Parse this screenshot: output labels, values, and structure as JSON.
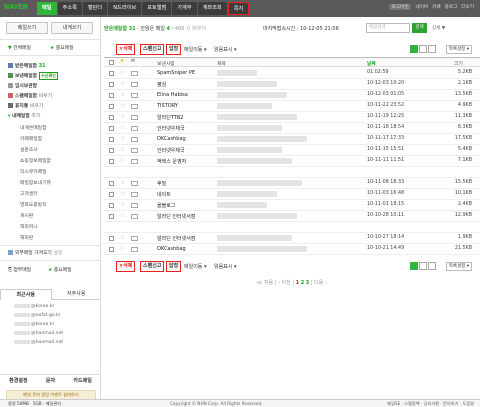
{
  "header": {
    "logo": "NAVER",
    "tabs": [
      "메일",
      "주소록",
      "캘린더",
      "N드라이브",
      "포토앨범",
      "가계부",
      "계좌조회",
      "쪽지"
    ],
    "right_links": [
      "로그아웃",
      "네이버",
      "카페",
      "블로그",
      "더보기"
    ]
  },
  "sidebar": {
    "write_btn": "메일쓰기",
    "self_btn": "내게쓰기",
    "all_mail": "전체메일",
    "important": "중요메일",
    "folders": [
      {
        "label": "받은메일함",
        "count": "31"
      },
      {
        "label": "보낸메일함",
        "badge": "수신확인"
      },
      {
        "label": "임시보관함"
      },
      {
        "label": "스팸메일함",
        "extra": "비우기"
      },
      {
        "label": "휴지통",
        "extra": "비우기"
      },
      {
        "label": "내메일함",
        "extra": "추가"
      }
    ],
    "sub_folders": [
      "내게쓴메일함",
      "카페메일함",
      "설문조사",
      "쇼핑정보메일함",
      "익스뷰카페일",
      "메일함보내기뷰",
      "고객센터",
      "영화도중방지",
      "게시판",
      "해외머니",
      "해외판"
    ],
    "external": "외부메일 가져오기",
    "external_extra": "설정",
    "attach": "첨부메일",
    "important2": "중요메일",
    "recent_tabs": [
      "최근사용",
      "자주사용"
    ],
    "contacts": [
      "@korea.kr",
      "@nofat.go.kr",
      "@korea.kr",
      "@hanmail.net",
      "@hanmail.net"
    ],
    "bottom": [
      "환경설정",
      "문자",
      "카드메일"
    ],
    "banner": "메일 문자 알림 이벤트 참여하기"
  },
  "main": {
    "stat_label": "받은메일함",
    "stat_count": "31",
    "stat_unread": "안읽은 메일",
    "stat_unread_count": "4",
    "stat_extra": "/ 406 ㅁ 비우기",
    "last_login": "마지막접속시간 : 10-12-05 21:06",
    "search_placeholder": "메일검색",
    "search_btn": "검색",
    "detail": "상세 ▼",
    "toolbar": {
      "delete": "×삭제",
      "spam": "스팸신고",
      "reply": "답장",
      "move": "메일이동 ▾",
      "read": "읽음표시 ▾",
      "sort": "목록설정 ▾"
    },
    "columns": {
      "sender": "보낸사람",
      "subject": "제목",
      "date": "날짜",
      "size": "크기"
    },
    "rows": [
      {
        "sender": "SpamSniper PE",
        "date": "01:02:59",
        "size": "5.2KB",
        "w": 40
      },
      {
        "sender": "평심",
        "date": "10-12-03 10:20",
        "size": "2.1KB",
        "w": 60
      },
      {
        "sender": "Elina Habisa",
        "date": "10-12-03 01:05",
        "size": "13.5KB",
        "w": 70
      },
      {
        "sender": "TISTORY",
        "date": "10-11-22 23:52",
        "size": "4.9KB",
        "w": 55
      },
      {
        "sender": "알라딘TTB2",
        "date": "10-11-19 12:25",
        "size": "11.3KB",
        "w": 80
      },
      {
        "sender": "인터넷우체국",
        "date": "10-11-18 18:54",
        "size": "8.3KB",
        "w": 65
      },
      {
        "sender": "OKCashbag",
        "date": "10-11-17 17:33",
        "size": "17.5KB",
        "w": 90
      },
      {
        "sender": "인터넷우체국",
        "date": "10-11-15 15:51",
        "size": "5.4KB",
        "w": 65
      },
      {
        "sender": "액택스 운영자",
        "date": "10-11-11 11:51",
        "size": "7.1KB",
        "w": 75
      },
      {
        "sender": "",
        "date": "",
        "size": "",
        "w": 0
      },
      {
        "sender": "후밀",
        "date": "10-11-08 18:33",
        "size": "15.5KB",
        "w": 85
      },
      {
        "sender": "네이트",
        "date": "10-11-03 16:48",
        "size": "10.1KB",
        "w": 60
      },
      {
        "sender": "올블로그",
        "date": "10-11-01 18:15",
        "size": "2.4KB",
        "w": 50
      },
      {
        "sender": "알라딘 인터넷서점",
        "date": "10-10-28 10:11",
        "size": "12.9KB",
        "w": 80
      },
      {
        "sender": "",
        "date": "",
        "size": "",
        "w": 0
      },
      {
        "sender": "알라딘 인터넷서점",
        "date": "10-10-27 18:14",
        "size": "1.9KB",
        "w": 75
      },
      {
        "sender": "OKCashbag",
        "date": "10-10-21 14:49",
        "size": "21.5KB",
        "w": 90
      }
    ],
    "pager": {
      "first": "≪ 처음",
      "prev": "‹ 이전",
      "pages": [
        "1",
        "2",
        "3"
      ],
      "next": "다음 ›"
    }
  },
  "footer": {
    "left": "용량 50MB · 5GB · 메일관리",
    "copy": "Copyright © NHN Corp. All Rights Reserved.",
    "right": "메일SE · 스팸정책 · 공지사항 · 문의하기 · 도움말"
  },
  "colors": {
    "accent": "#2fb63a",
    "highlight": "#e52421",
    "topbar": "#5a5a5a"
  }
}
